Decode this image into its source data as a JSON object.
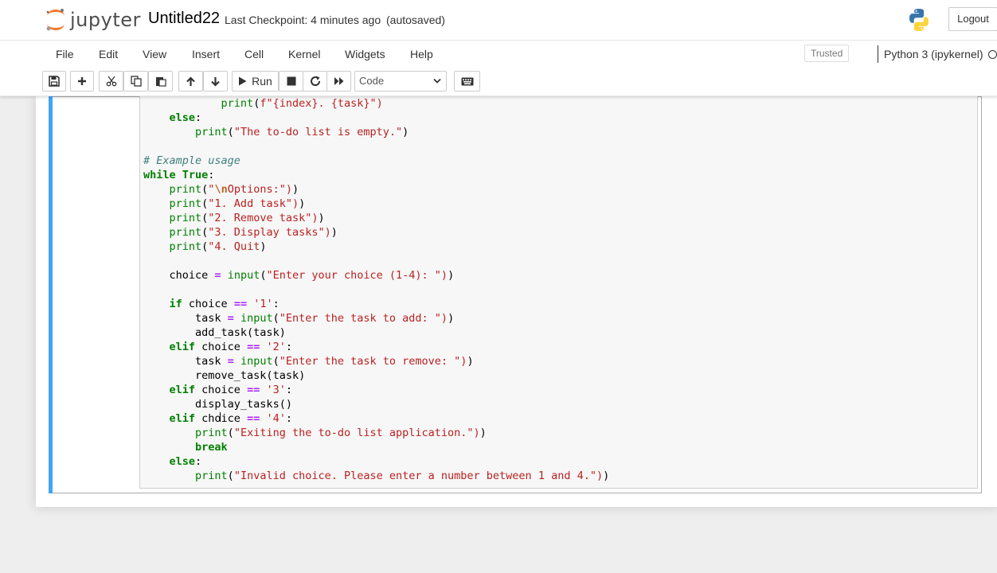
{
  "header": {
    "logo_text": "jupyter",
    "notebook_name": "Untitled22",
    "checkpoint": "Last Checkpoint: 4 minutes ago",
    "autosave": "(autosaved)",
    "logout_label": "Logout"
  },
  "menubar": {
    "items": [
      "File",
      "Edit",
      "View",
      "Insert",
      "Cell",
      "Kernel",
      "Widgets",
      "Help"
    ],
    "trusted_label": "Trusted",
    "kernel_name": "Python 3 (ipykernel)"
  },
  "toolbar": {
    "run_label": "Run",
    "cell_type": "Code"
  },
  "code_lines": [
    "            print(f\"{index}. {task}\")",
    "    else:",
    "        print(\"The to-do list is empty.\")",
    "",
    "# Example usage",
    "while True:",
    "    print(\"\\nOptions:\")",
    "    print(\"1. Add task\")",
    "    print(\"2. Remove task\")",
    "    print(\"3. Display tasks\")",
    "    print(\"4. Quit\")",
    "",
    "    choice = input(\"Enter your choice (1-4): \")",
    "",
    "    if choice == '1':",
    "        task = input(\"Enter the task to add: \")",
    "        add_task(task)",
    "    elif choice == '2':",
    "        task = input(\"Enter the task to remove: \")",
    "        remove_task(task)",
    "    elif choice == '3':",
    "        display_tasks()",
    "    elif choice == '4':",
    "        print(\"Exiting the to-do list application.\")",
    "        break",
    "    else:",
    "        print(\"Invalid choice. Please enter a number between 1 and 4.\")"
  ],
  "colors": {
    "cell_selected_bar": "#42a5f5",
    "keyword": "#008000",
    "string": "#ba2121",
    "operator": "#aa22ff",
    "comment": "#408080"
  }
}
